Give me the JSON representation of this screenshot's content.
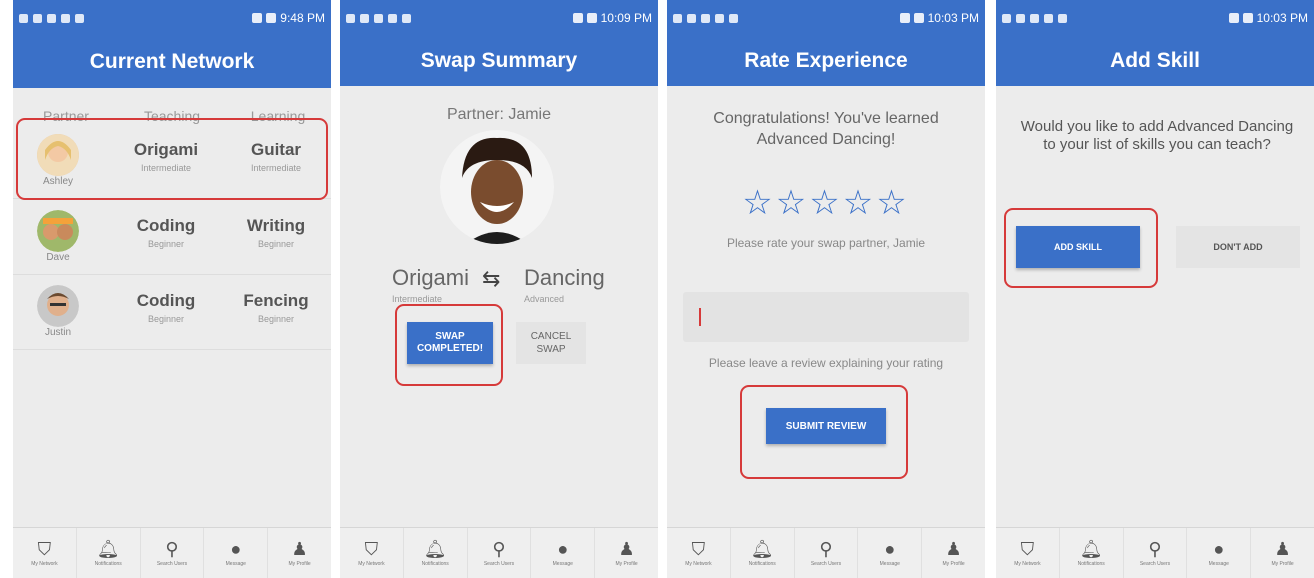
{
  "status_times": [
    "9:48 PM",
    "10:09 PM",
    "10:03 PM",
    "10:03 PM"
  ],
  "screen1": {
    "title": "Current Network",
    "headers": [
      "Partner",
      "Teaching",
      "Learning"
    ],
    "rows": [
      {
        "name": "Ashley",
        "teach": "Origami",
        "teach_level": "Intermediate",
        "learn": "Guitar",
        "learn_level": "Intermediate"
      },
      {
        "name": "Dave",
        "teach": "Coding",
        "teach_level": "Beginner",
        "learn": "Writing",
        "learn_level": "Beginner"
      },
      {
        "name": "Justin",
        "teach": "Coding",
        "teach_level": "Beginner",
        "learn": "Fencing",
        "learn_level": "Beginner"
      }
    ]
  },
  "screen2": {
    "title": "Swap Summary",
    "partner": "Partner: Jamie",
    "teach": "Origami",
    "teach_level": "Intermediate",
    "learn": "Dancing",
    "learn_level": "Advanced",
    "complete_label": "SWAP COMPLETED!",
    "cancel_label": "CANCEL SWAP"
  },
  "screen3": {
    "title": "Rate Experience",
    "congrats": "Congratulations! You've learned Advanced Dancing!",
    "stars": 5,
    "rate_prompt": "Please rate your swap partner, Jamie",
    "review_value": "",
    "review_hint": "Please leave a review explaining your rating",
    "submit_label": "SUBMIT REVIEW"
  },
  "screen4": {
    "title": "Add Skill",
    "question": "Would you like to add Advanced Dancing to your list of skills you can teach?",
    "add_label": "ADD SKILL",
    "dont_label": "DON'T ADD"
  },
  "nav": [
    {
      "label": "My Network",
      "icon": "network-icon"
    },
    {
      "label": "Notifications",
      "icon": "bell-icon"
    },
    {
      "label": "Search Users",
      "icon": "search-user-icon"
    },
    {
      "label": "Message",
      "icon": "chat-icon"
    },
    {
      "label": "My Profile",
      "icon": "person-icon"
    }
  ],
  "colors": {
    "primary": "#3a70c8",
    "highlight": "#d63a3a",
    "star": "#3a70c8"
  }
}
